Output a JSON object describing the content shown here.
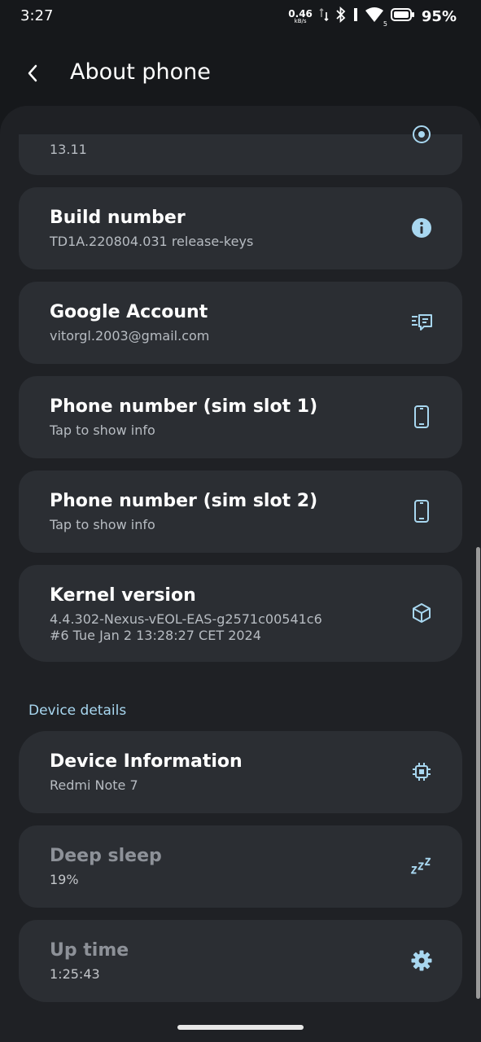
{
  "status_bar": {
    "time": "3:27",
    "net_speed_value": "0.46",
    "net_speed_unit": "kB/s",
    "signal_label": "5",
    "battery_percent": "95%"
  },
  "app_bar": {
    "title": "About phone"
  },
  "cards": {
    "partial": {
      "subtitle": "13.11",
      "icon": "target-icon"
    },
    "build": {
      "title": "Build number",
      "subtitle": "TD1A.220804.031 release-keys",
      "icon": "info-icon"
    },
    "google": {
      "title": "Google Account",
      "subtitle": "vitorgl.2003@gmail.com",
      "icon": "account-list-icon"
    },
    "sim1": {
      "title": "Phone number (sim slot 1)",
      "subtitle": "Tap to show info",
      "icon": "phone-icon"
    },
    "sim2": {
      "title": "Phone number (sim slot 2)",
      "subtitle": "Tap to show info",
      "icon": "phone-icon"
    },
    "kernel": {
      "title": "Kernel version",
      "subtitle": "4.4.302-Nexus-vEOL-EAS-g2571c00541c6\n#6 Tue Jan 2 13:28:27 CET 2024",
      "icon": "cube-icon"
    }
  },
  "device_details": {
    "header": "Device details",
    "device_info": {
      "title": "Device Information",
      "subtitle": "Redmi Note 7",
      "icon": "chip-icon"
    },
    "deep_sleep": {
      "title": "Deep sleep",
      "subtitle": "19%",
      "icon": "sleep-zzz-icon"
    },
    "up_time": {
      "title": "Up time",
      "subtitle": "1:25:43",
      "icon": "gear-icon"
    }
  },
  "colors": {
    "background": "#16181b",
    "panel": "#1f2125",
    "card": "#2b2e33",
    "accent": "#a8d7f0"
  }
}
